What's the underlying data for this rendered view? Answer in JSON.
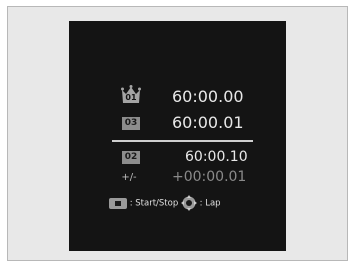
{
  "stopwatch": {
    "best_lap": {
      "badge": "01",
      "time": "60:00.00"
    },
    "current_lap": {
      "badge": "03",
      "time": "60:00.01"
    },
    "previous_lap": {
      "badge": "02",
      "time": "60:00.10"
    },
    "difference": {
      "label": "+/-",
      "time": "+00:00.01"
    },
    "legend": {
      "start_stop_label": ": Start/Stop",
      "lap_label": ": Lap",
      "start_stop_icon": "button-icon",
      "lap_icon": "selector-dial-icon"
    }
  },
  "colors": {
    "screen_bg": "#141414",
    "text_primary": "#e8e8e8",
    "text_dim": "#8a8a8a",
    "badge_bg": "#8d8d8d",
    "panel_bg": "#e8e8e8"
  }
}
